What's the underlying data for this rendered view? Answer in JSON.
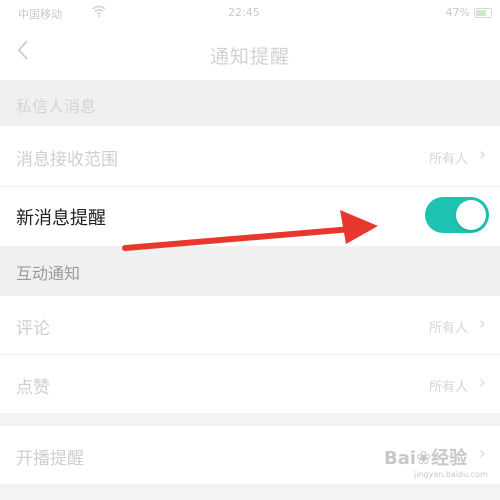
{
  "status_bar": {
    "carrier": "中国移动",
    "time": "22:45",
    "battery": "47%"
  },
  "nav": {
    "back_icon": "chevron-left-icon",
    "title": "通知提醒"
  },
  "sections": {
    "private_header": "私信人消息",
    "private_scope_label": "消息接收范围",
    "private_scope_value": "所有人",
    "new_msg_label": "新消息提醒",
    "new_msg_enabled": true,
    "interaction_header": "互动通知",
    "comment_label": "评论",
    "comment_value": "所有人",
    "like_label": "点赞",
    "like_value": "所有人",
    "live_label": "开播提醒"
  },
  "colors": {
    "toggle_on": "#1dc2b1",
    "annotation_arrow": "#e8382e"
  },
  "watermark": {
    "brand": "Bai",
    "brand2": "经验",
    "url": "jingyan.baidu.com"
  }
}
